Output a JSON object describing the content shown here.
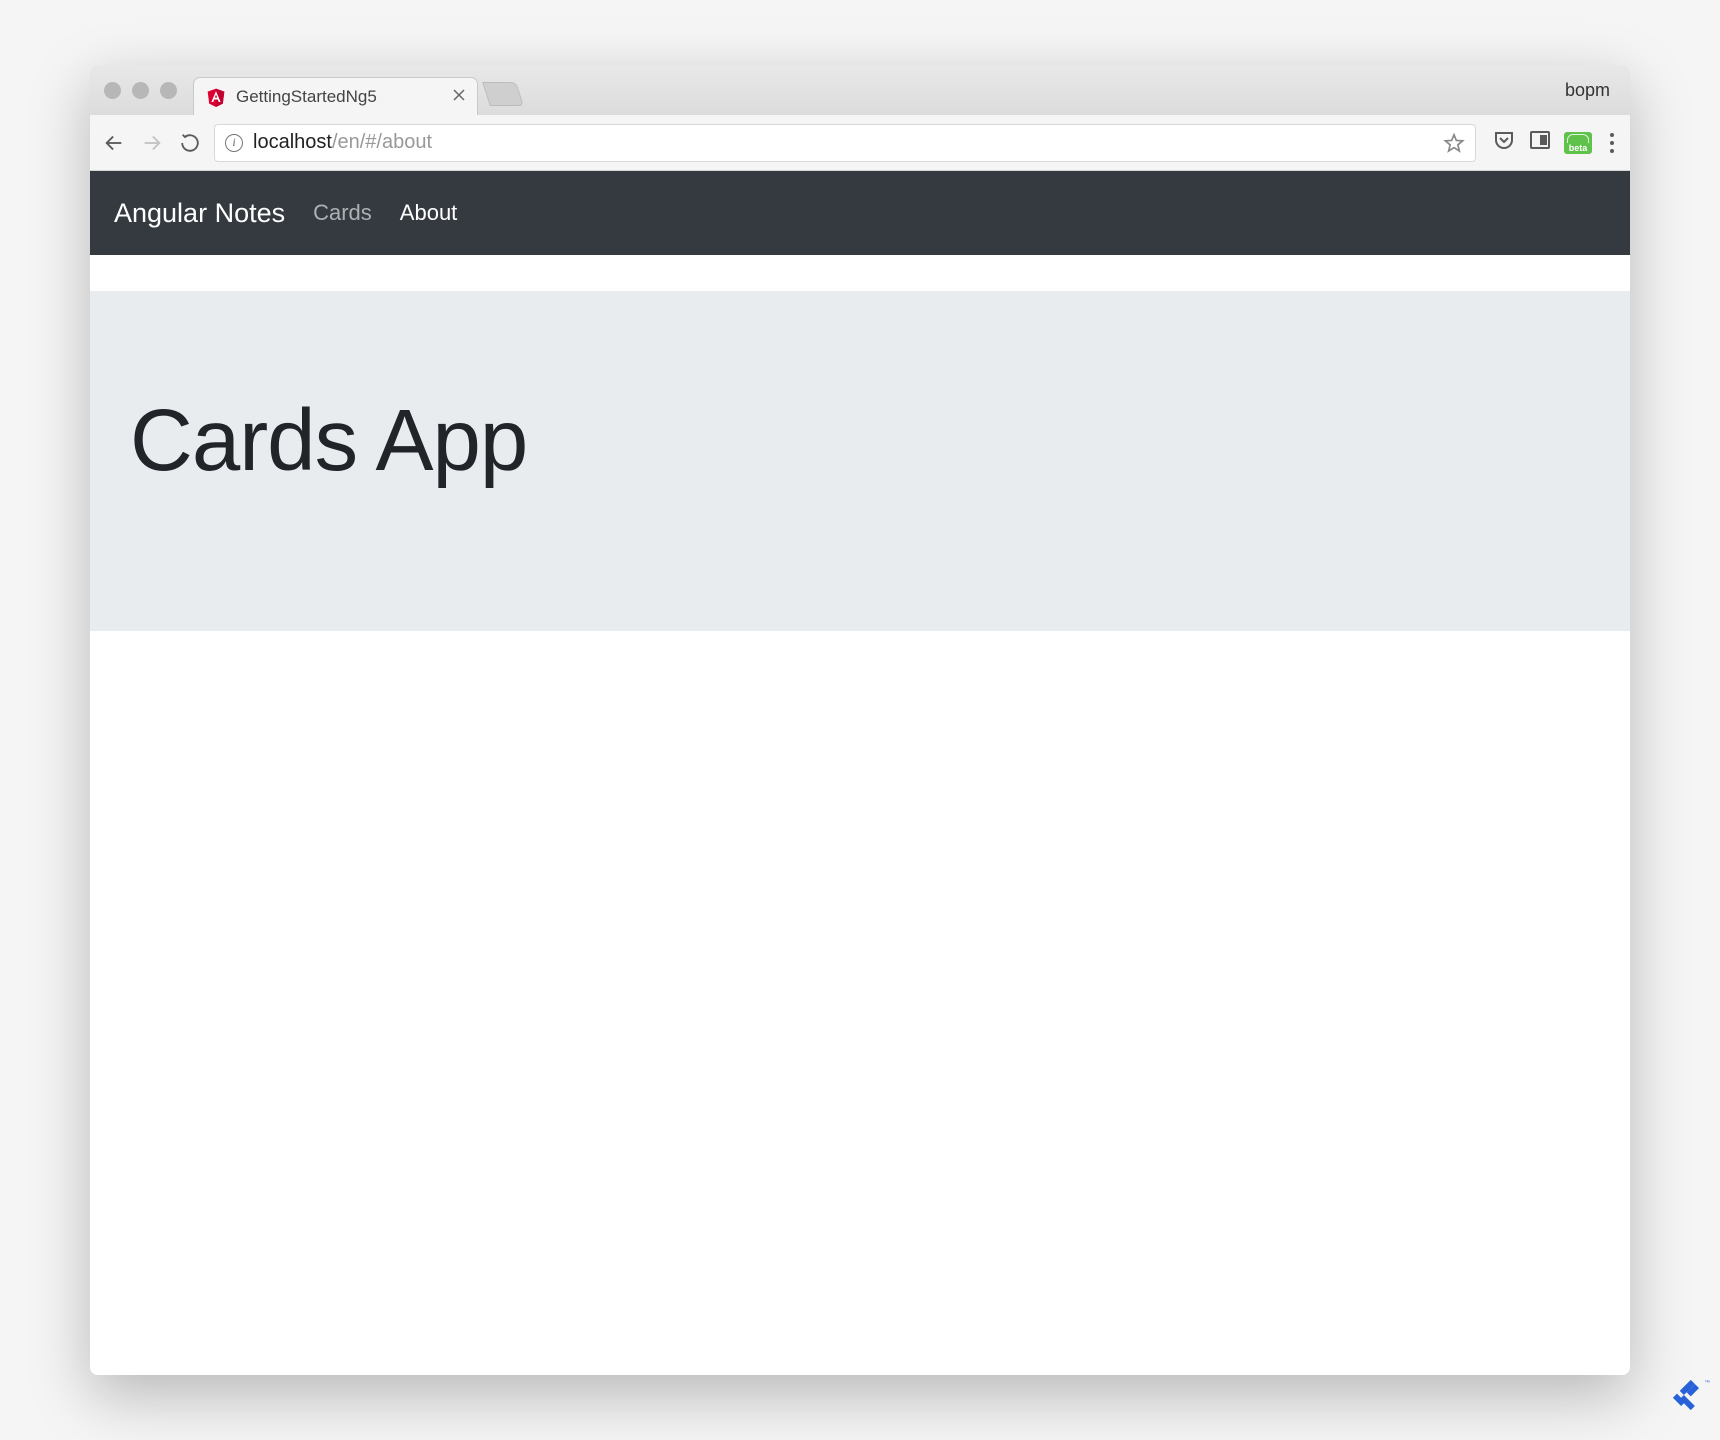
{
  "browser": {
    "tab_title": "GettingStartedNg5",
    "user_label": "bopm",
    "url_host": "localhost",
    "url_path": "/en/#/about",
    "beta_label": "beta"
  },
  "navbar": {
    "brand": "Angular Notes",
    "links": [
      {
        "label": "Cards",
        "active": false
      },
      {
        "label": "About",
        "active": true
      }
    ]
  },
  "page": {
    "heading": "Cards App"
  }
}
